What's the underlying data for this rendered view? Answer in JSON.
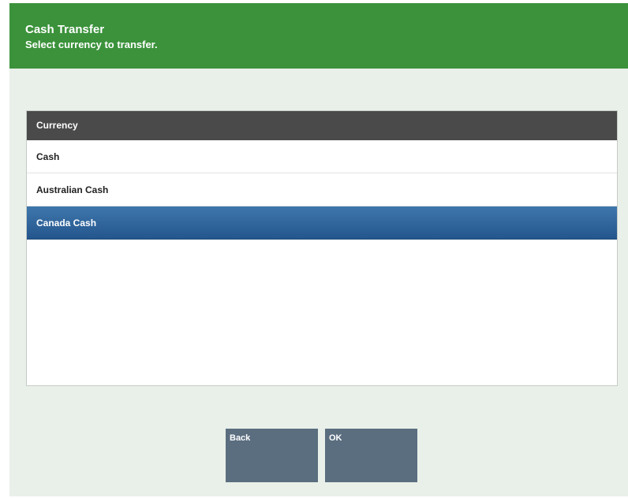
{
  "header": {
    "title": "Cash Transfer",
    "subtitle": "Select currency to transfer."
  },
  "currency_list": {
    "column_header": "Currency",
    "items": [
      {
        "label": "Cash",
        "selected": false
      },
      {
        "label": "Australian Cash",
        "selected": false
      },
      {
        "label": "Canada Cash",
        "selected": true
      }
    ]
  },
  "buttons": {
    "back_label": "Back",
    "ok_label": "OK"
  },
  "colors": {
    "header_background": "#3b923b",
    "page_background": "#e9f0e9",
    "column_header_background": "#4a4a4a",
    "selected_row": "#2f6aa3",
    "button_background": "#5b6e80"
  }
}
